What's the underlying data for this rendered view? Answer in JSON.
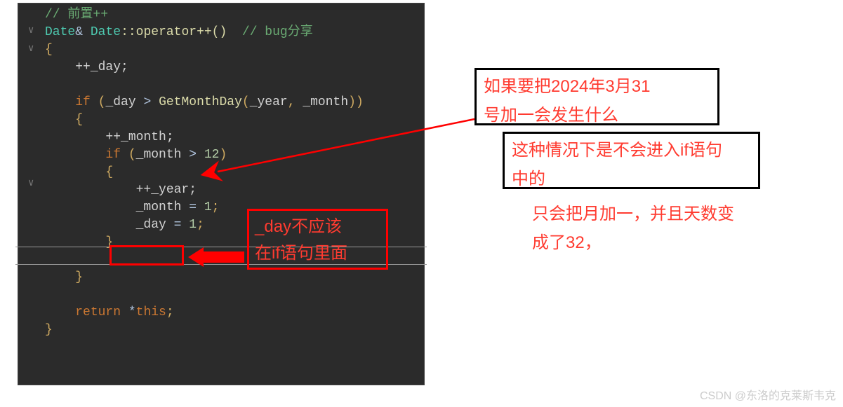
{
  "code": {
    "comment_prefix": "// 前置++",
    "decl_type": "Date",
    "decl_amp": "&",
    "decl_class": "Date",
    "decl_op": "::operator++()",
    "bug_comment": "// bug分享",
    "brace_open": "{",
    "inc_day": "++_day;",
    "empty": "",
    "if_kw": "if",
    "if_open": " (",
    "var_day": "_day",
    "gt": " > ",
    "fn_getmonth": "GetMonthDay",
    "call_open": "(",
    "var_year": "_year",
    "comma": ", ",
    "var_month": "_month",
    "call_close": "))",
    "brace_open2": "{",
    "inc_month": "++_month;",
    "if2_kw": "if",
    "if2_open": " (",
    "gt2": " > ",
    "twelve": "12",
    "paren_close": ")",
    "brace_open3": "{",
    "inc_year": "++_year;",
    "set_month_var": "_month",
    "set_month_rest": " = ",
    "one": "1",
    "semicolon": ";",
    "set_day_var": "_day",
    "brace_close3": "}",
    "brace_close2": "}",
    "return_kw": "return",
    "star_this": " *",
    "this_kw": "this",
    "brace_close": "}"
  },
  "overlay": {
    "big_comment_line1": "_day不应该",
    "big_comment_line2": "在if语句里面"
  },
  "annotations": {
    "a1_line1": "如果要把2024年3月31",
    "a1_line2": "号加一会发生什么",
    "a2_line1": "这种情况下是不会进入if语句",
    "a2_line2": "中的",
    "a3_line1": "只会把月加一，并且天数变",
    "a3_line2": "成了32，"
  },
  "watermark": "CSDN @东洛的克莱斯韦克"
}
